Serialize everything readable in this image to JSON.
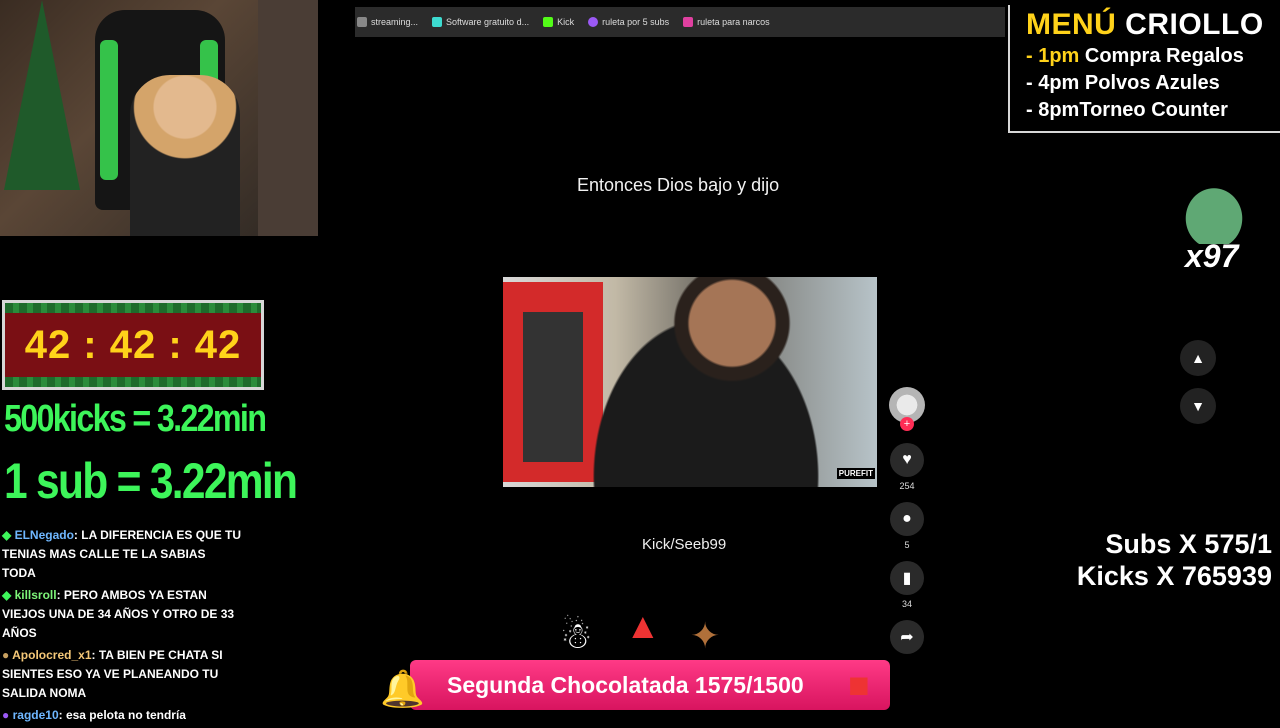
{
  "browser": {
    "tabs": [
      {
        "label": "streaming...",
        "color": "#888888"
      },
      {
        "label": "Software gratuito d...",
        "color": "#3ddbd0"
      },
      {
        "label": "Kick",
        "color": "#53fc18"
      },
      {
        "label": "ruleta por 5 subs",
        "color": "#9b59f5"
      },
      {
        "label": "ruleta para narcos",
        "color": "#e040a0"
      }
    ]
  },
  "timer": {
    "value": "42 : 42 : 42"
  },
  "rules": {
    "kicks": "500kicks = 3.22min",
    "sub": "1 sub = 3.22min"
  },
  "chat": [
    {
      "user": "ELNegado",
      "text": ": LA DIFERENCIA ES QUE TU TENIAS MAS CALLE TE LA SABIAS TODA"
    },
    {
      "user": "killsroll",
      "text": ": PERO AMBOS YA ESTAN VIEJOS UNA DE 34 AÑOS Y OTRO DE 33 AÑOS"
    },
    {
      "user": "Apolocred_x1",
      "text": ": TA BIEN PE CHATA SI SIENTES ESO YA VE PLANEANDO TU SALIDA NOMA"
    },
    {
      "user": "ragde10",
      "text": ": esa pelota no tendría"
    }
  ],
  "post": {
    "caption": "Entonces Dios bajo y dijo",
    "handle": "Kick/Seeb99",
    "video_watermark": "PUREFIT",
    "likes": "254",
    "comments": "5",
    "saves": "34"
  },
  "menu": {
    "title_a": "MENÚ",
    "title_b": " CRIOLLO",
    "items": [
      {
        "time": "- 1pm",
        "text": " Compra Regalos"
      },
      {
        "time": "- 4pm",
        "text": " Polvos Azules"
      },
      {
        "time": "- 8pm",
        "text": "Torneo Counter"
      }
    ]
  },
  "frog_count": "x97",
  "stats": {
    "subs": "Subs X 575/1",
    "kicks": "Kicks X 765939"
  },
  "banner": {
    "text": "Segunda Chocolatada 1575/1500"
  }
}
